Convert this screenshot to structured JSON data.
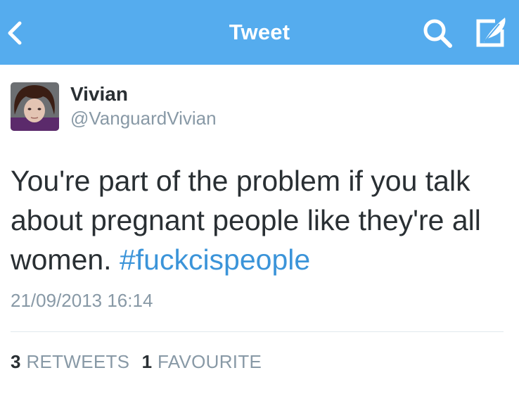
{
  "nav": {
    "title": "Tweet",
    "back_icon": "chevron-left-icon",
    "search_icon": "search-icon",
    "compose_icon": "compose-tweet-icon",
    "background_color": "#55acee"
  },
  "tweet": {
    "author": {
      "display_name": "Vivian",
      "handle": "@VanguardVivian"
    },
    "text": "You're part of the problem if you talk about pregnant people like they're all women. ",
    "hashtag": "#fuckcispeople",
    "timestamp": "21/09/2013 16:14",
    "stats": {
      "retweets_count": "3",
      "retweets_label": "RETWEETS",
      "favourites_count": "1",
      "favourites_label": "FAVOURITE"
    }
  },
  "colors": {
    "link": "#3b94d9",
    "muted": "#8899a6",
    "text": "#292f33",
    "divider": "#e1e8ed"
  }
}
